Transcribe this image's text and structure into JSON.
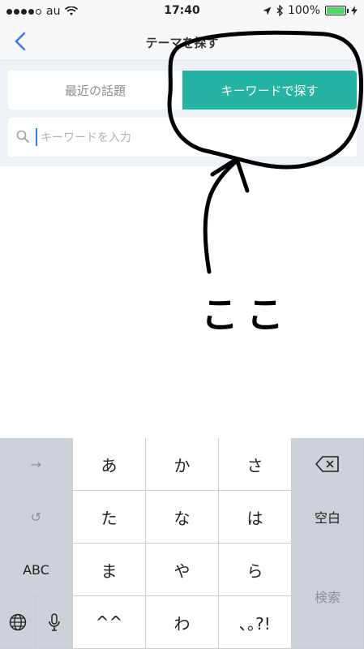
{
  "status_bar": {
    "carrier": "au",
    "time": "17:40",
    "battery_percent": "100%",
    "signal_bars": 4
  },
  "nav": {
    "title": "テーマを探す",
    "back_icon": "chevron-left-icon"
  },
  "segment": {
    "options": [
      "最近の話題",
      "キーワードで探す"
    ],
    "selected_index": 1
  },
  "search": {
    "placeholder": "キーワードを入力",
    "value": ""
  },
  "annotation": {
    "text": "ここ"
  },
  "keyboard": {
    "left_keys": [
      "→",
      "↺",
      "ABC"
    ],
    "kana_rows": [
      [
        "あ",
        "か",
        "さ"
      ],
      [
        "た",
        "な",
        "は"
      ],
      [
        "ま",
        "や",
        "ら"
      ],
      [
        "^^",
        "わ",
        "､｡?!"
      ]
    ],
    "right_keys": [
      "⌫",
      "空白",
      "検索"
    ],
    "globe_icon": "globe-icon",
    "mic_icon": "microphone-icon"
  },
  "colors": {
    "accent": "#26b3a4",
    "link_blue": "#3b7de8"
  }
}
